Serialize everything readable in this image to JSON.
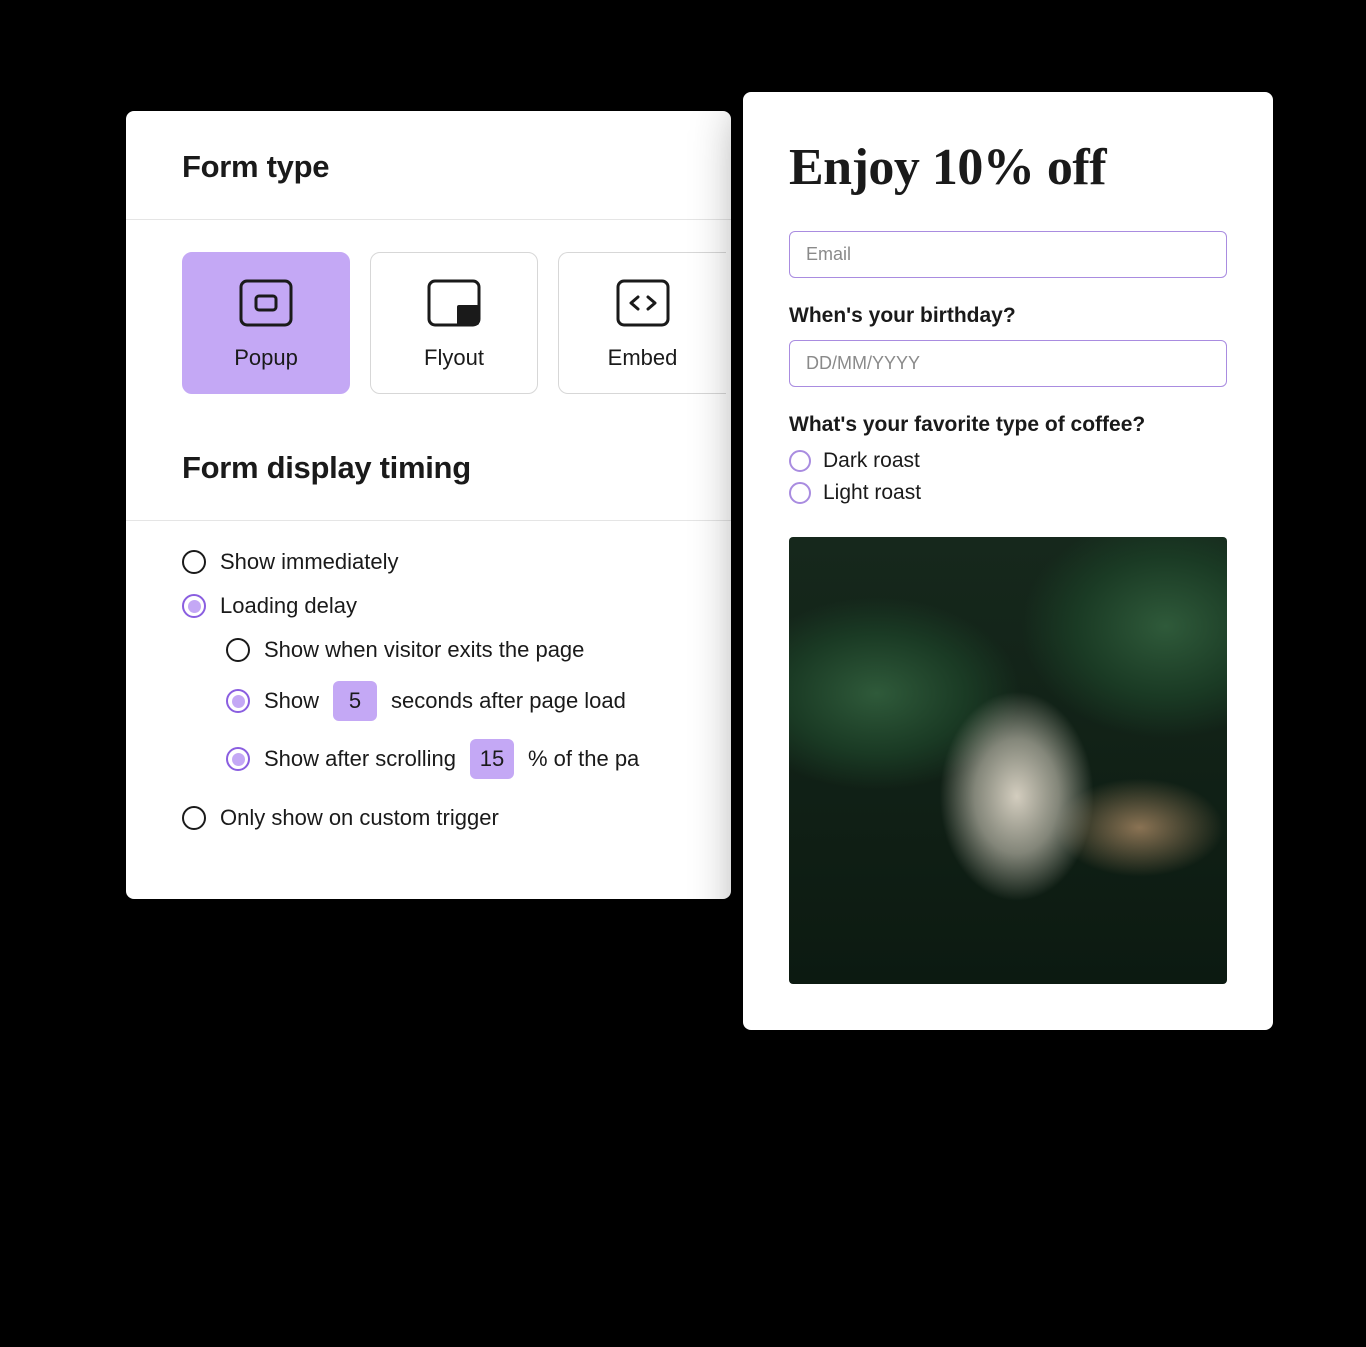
{
  "settings": {
    "formTypeTitle": "Form type",
    "types": [
      {
        "label": "Popup",
        "selected": true
      },
      {
        "label": "Flyout",
        "selected": false
      },
      {
        "label": "Embed",
        "selected": false
      }
    ],
    "timingTitle": "Form display timing",
    "options": {
      "immediate": {
        "label": "Show immediately",
        "selected": false
      },
      "loading": {
        "label": "Loading delay",
        "selected": true
      },
      "exit": {
        "label": "Show when visitor exits the page",
        "selected": false
      },
      "seconds": {
        "prefix": "Show",
        "value": "5",
        "suffix": "seconds after page load",
        "selected": true
      },
      "scroll": {
        "prefix": "Show after scrolling",
        "value": "15",
        "suffix": "% of the pa",
        "selected": true
      },
      "custom": {
        "label": "Only show on custom trigger",
        "selected": false
      }
    }
  },
  "preview": {
    "title": "Enjoy 10% off",
    "emailPlaceholder": "Email",
    "birthdayLabel": "When's your birthday?",
    "birthdayPlaceholder": "DD/MM/YYYY",
    "coffeeLabel": "What's your favorite type of coffee?",
    "choices": [
      {
        "label": "Dark roast"
      },
      {
        "label": "Light roast"
      }
    ]
  }
}
